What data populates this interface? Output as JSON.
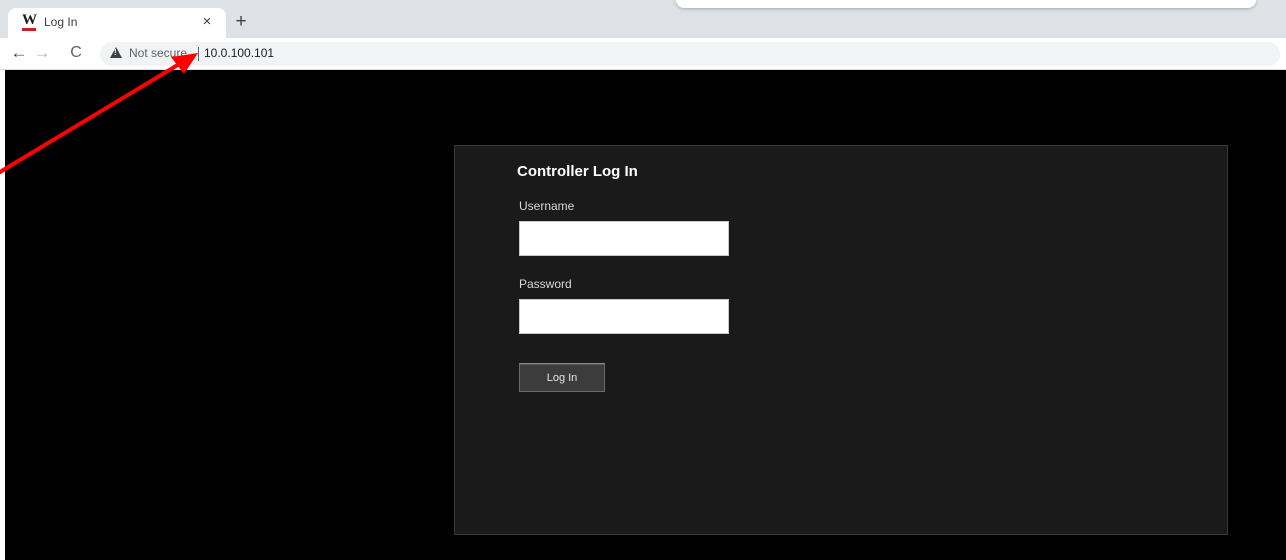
{
  "browser": {
    "tab": {
      "favicon_letter": "W",
      "title": "Log In",
      "close_glyph": "×"
    },
    "new_tab_glyph": "+",
    "nav": {
      "back_glyph": "←",
      "forward_glyph": "→",
      "reload_glyph": "C"
    },
    "omnibox": {
      "security_label": "Not secure",
      "url": "10.0.100.101"
    }
  },
  "login": {
    "title": "Controller Log In",
    "username_label": "Username",
    "username_value": "",
    "password_label": "Password",
    "password_value": "",
    "submit_label": "Log In"
  },
  "colors": {
    "page_bg": "#000000",
    "panel_bg": "#1a1a1a",
    "button_bg": "#3c3c3c",
    "annotation_arrow": "#ff0000",
    "favicon_underline": "#cc1f1f"
  },
  "icons": {
    "security": "warning-triangle-icon",
    "back": "arrow-left-icon",
    "forward": "arrow-right-icon",
    "reload": "reload-icon",
    "close": "close-icon",
    "new_tab": "plus-icon"
  }
}
